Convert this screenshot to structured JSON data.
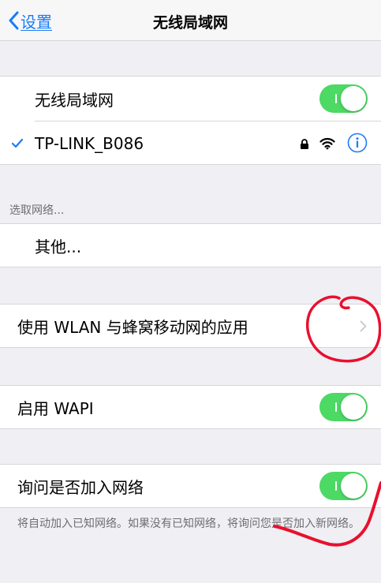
{
  "navbar": {
    "back_label": "设置",
    "title": "无线局域网"
  },
  "wifi": {
    "toggle_label": "无线局域网",
    "toggle_on": true,
    "connected_network": "TP-LINK_B086",
    "connected_check": "✓",
    "connected_lock": "locked",
    "connected_info": "i"
  },
  "choose_network": {
    "section_label": "选取网络...",
    "other_label": "其他..."
  },
  "wlan_apps": {
    "label": "使用 WLAN 与蜂窝移动网的应用",
    "chevron": "›"
  },
  "wapi": {
    "label": "启用 WAPI",
    "toggle_on": true
  },
  "ask_join": {
    "label": "询问是否加入网络",
    "toggle_on": true,
    "footer": "将自动加入已知网络。如果没有已知网络，将询问您是否加入新网络。"
  },
  "colors": {
    "accent": "#1a7cf5",
    "toggle_on": "#4cd964",
    "background": "#efeff4",
    "annotation": "#e8102e"
  },
  "icons": [
    "chevron-left-icon",
    "checkmark-icon",
    "lock-icon",
    "wifi-icon",
    "info-icon",
    "chevron-right-icon"
  ]
}
